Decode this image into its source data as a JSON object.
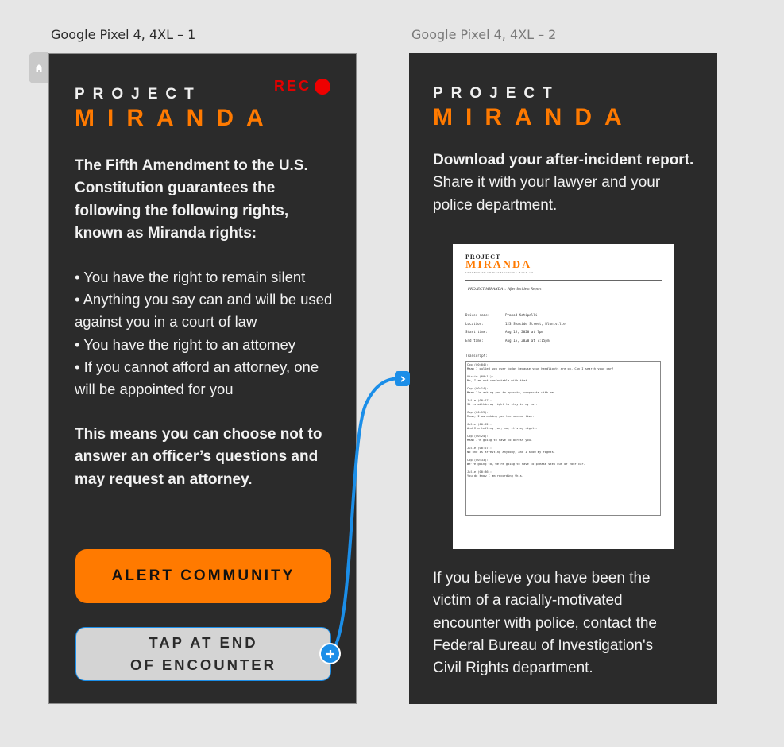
{
  "artboards": {
    "first_label": "Google Pixel 4, 4XL – 1",
    "second_label": "Google Pixel 4, 4XL – 2"
  },
  "colors": {
    "canvas": "#e6e6e6",
    "screen_bg": "#2b2b2b",
    "accent_orange": "#ff7a00",
    "rec_red": "#e10000",
    "prototype_blue": "#1b8ee8"
  },
  "brand": {
    "top": "PROJECT",
    "main": "MIRANDA"
  },
  "screen1": {
    "rec_label": "REC",
    "intro": "The Fifth Amendment to the U.S. Constitution guarantees the following the following rights, known as Miranda rights:",
    "rights": [
      "• You have the right to remain silent",
      "• Anything you say can and will be used against you in a court of law",
      "• You have the right to an attorney",
      "• If you cannot afford an attorney, one will be appointed for you"
    ],
    "summary": "This means you can choose not to answer an officer’s questions and may request an attorney.",
    "alert_button": "ALERT COMMUNITY",
    "tap_button_line1": "TAP AT END",
    "tap_button_line2": "OF ENCOUNTER"
  },
  "screen2": {
    "download_bold": "Download your after-incident report.",
    "download_rest": "Share it with your lawyer and your police department.",
    "footer": "If you believe you have been the victim of a racially-motivated encounter with police, contact the Federal Bureau of Investigation's Civil Rights department."
  },
  "report": {
    "project": "PROJECT",
    "miranda": "MIRANDA",
    "subtitle": "UNIVERSITY OF WASHINGTON · HACK '20",
    "title": "PROJECT MIRANDA :: After-Incident Report",
    "meta": [
      {
        "key": "Driver name:",
        "value": "Pramod Kotipalli"
      },
      {
        "key": "Location:",
        "value": "123 Seaside Street, Bluntville"
      },
      {
        "key": "Start time:",
        "value": "Aug 15, 2020 at 7pm"
      },
      {
        "key": "End time:",
        "value": "Aug 15, 2020 at 7:15pm"
      }
    ],
    "transcript_label": "Transcript:",
    "transcript": [
      {
        "speaker": "Cop (00:04):",
        "text": "Maam I pulled you over today because your headlights are on. Can I search your car?"
      },
      {
        "speaker": "Victim (00:11):",
        "text": "No, I am not comfortable with that."
      },
      {
        "speaker": "Cop (00:14):",
        "text": "Maam I'm asking you to operate, cooperate with me."
      },
      {
        "speaker": "Julie (00:17):",
        "text": "It is within my right to stay in my car."
      },
      {
        "speaker": "Cop (00:19):",
        "text": "Maam, I am asking you the second time."
      },
      {
        "speaker": "Julie (00:22):",
        "text": "And I'm telling you, no, it's my rights."
      },
      {
        "speaker": "Cop (00:24):",
        "text": "Maam I'm going to have to arrest you."
      },
      {
        "speaker": "Julie (00:27):",
        "text": "No one is arresting anybody, and I know my rights."
      },
      {
        "speaker": "Cop (00:33):",
        "text": "We're going to, we're going to have to please step out of your car."
      },
      {
        "speaker": "Julie (00:36):",
        "text": "You do know I am recording this."
      }
    ]
  }
}
